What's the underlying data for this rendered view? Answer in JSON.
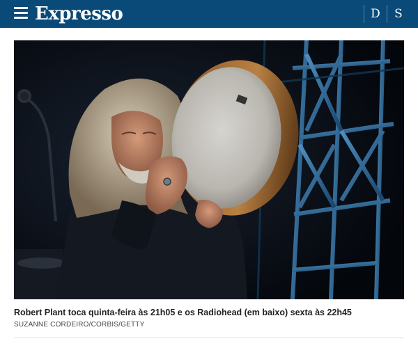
{
  "header": {
    "logo": "Expresso",
    "links": [
      "D",
      "S"
    ]
  },
  "article": {
    "caption": "Robert Plant toca quinta-feira às 21h05 e os Radiohead (em baixo) sexta às 22h45",
    "credit": "SUZANNE CORDEIRO/CORBIS/GETTY"
  },
  "colors": {
    "header_bg": "#0a4a78",
    "header_text": "#ffffff",
    "stage_light": "#3f8fc8"
  },
  "icons": {
    "menu": "hamburger-menu-icon"
  }
}
